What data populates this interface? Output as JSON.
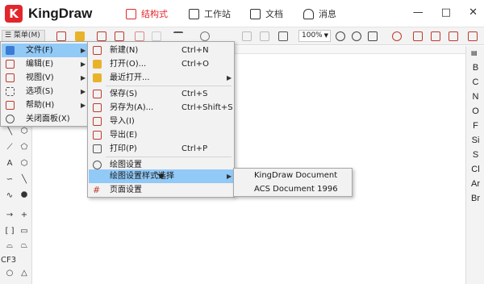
{
  "app": {
    "logo_letter": "K",
    "name": "KingDraw"
  },
  "nav_tabs": [
    {
      "label": "结构式",
      "active": true
    },
    {
      "label": "工作站",
      "active": false
    },
    {
      "label": "文档",
      "active": false
    },
    {
      "label": "消息",
      "active": false
    }
  ],
  "window_controls": {
    "minimize": "—",
    "maximize": "□",
    "close": "✕"
  },
  "toolbar": {
    "menu_label": "☰ 菜单(M)",
    "zoom": "100%"
  },
  "left_tools": {
    "cf3_label": "CF3"
  },
  "elements": [
    "B",
    "C",
    "N",
    "O",
    "F",
    "Si",
    "S",
    "Cl",
    "Ar",
    "Br"
  ],
  "main_menu": [
    {
      "label": "文件(F)",
      "arrow": "▶",
      "highlighted": true
    },
    {
      "label": "编辑(E)",
      "arrow": "▶"
    },
    {
      "label": "视图(V)",
      "arrow": "▶"
    },
    {
      "label": "选项(S)",
      "arrow": "▶"
    },
    {
      "label": "帮助(H)",
      "arrow": "▶"
    },
    {
      "label": "关闭面板(X)",
      "arrow": ""
    }
  ],
  "file_menu": [
    {
      "label": "新建(N)",
      "shortcut": "Ctrl+N"
    },
    {
      "label": "打开(O)...",
      "shortcut": "Ctrl+O"
    },
    {
      "label": "最近打开...",
      "shortcut": "",
      "arrow": "▶"
    },
    {
      "label": "保存(S)",
      "shortcut": "Ctrl+S"
    },
    {
      "label": "另存为(A)...",
      "shortcut": "Ctrl+Shift+S"
    },
    {
      "label": "导入(I)",
      "shortcut": ""
    },
    {
      "label": "导出(E)",
      "shortcut": ""
    },
    {
      "label": "打印(P)",
      "shortcut": "Ctrl+P"
    },
    {
      "label": "绘图设置",
      "shortcut": ""
    },
    {
      "label": "绘图设置样式选择",
      "shortcut": "",
      "arrow": "▶",
      "highlighted": true
    },
    {
      "label": "页面设置",
      "shortcut": ""
    }
  ],
  "style_submenu": [
    {
      "label": "KingDraw Document"
    },
    {
      "label": "ACS Document 1996"
    }
  ]
}
